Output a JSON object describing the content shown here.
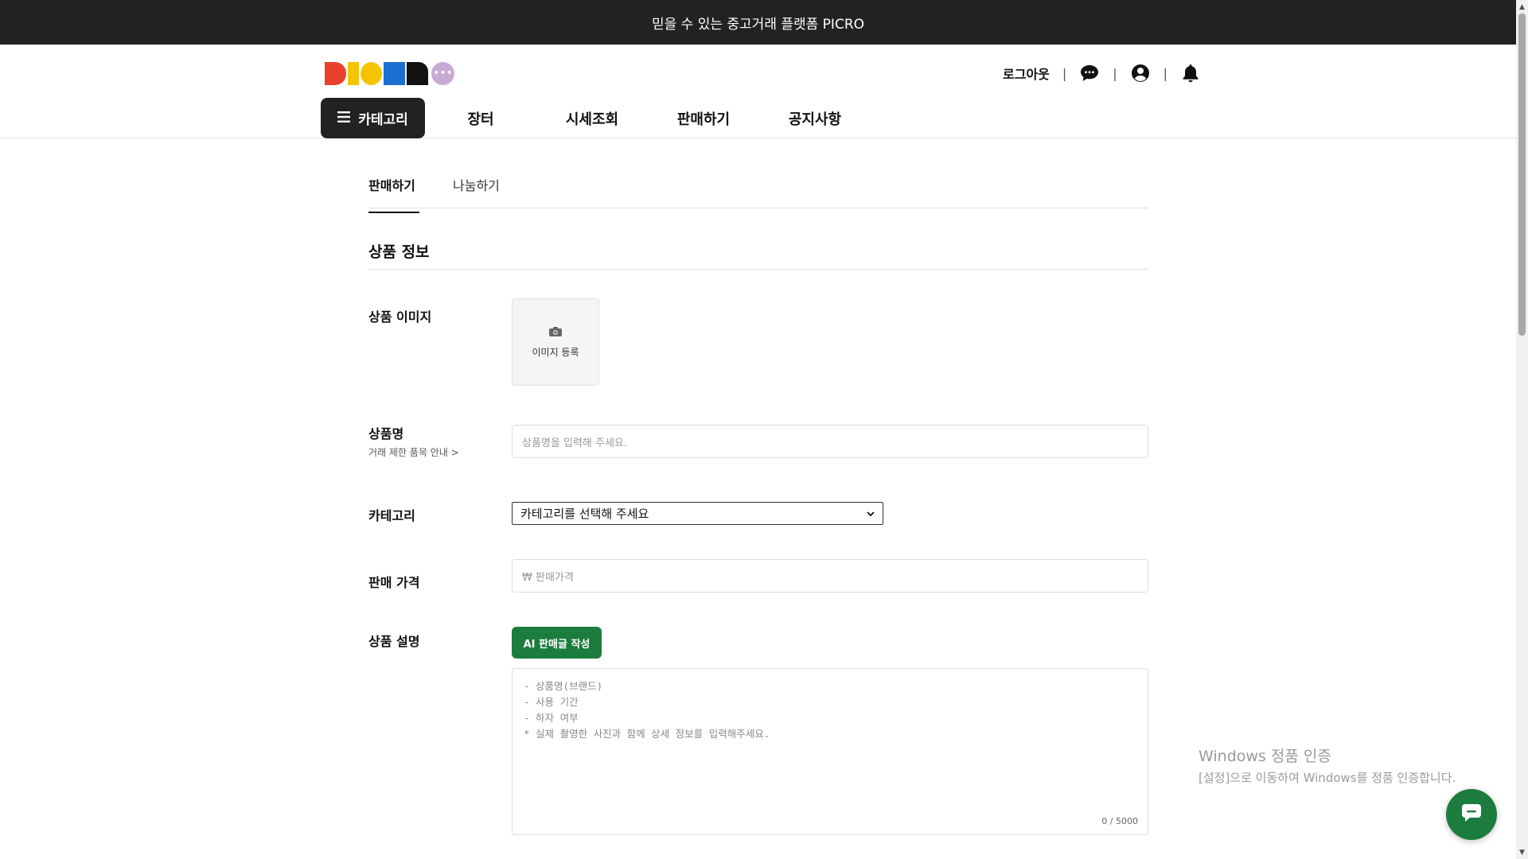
{
  "announcement": "믿을 수 있는 중고거래 플랫폼 PICRO",
  "header": {
    "logo_alt": "PICRO",
    "logout_label": "로그아웃",
    "separator": "|"
  },
  "nav": {
    "category_button": "카테고리",
    "items": [
      "장터",
      "시세조회",
      "판매하기",
      "공지사항"
    ]
  },
  "tabs": {
    "sell": "판매하기",
    "share": "나눔하기"
  },
  "form": {
    "section_title": "상품 정보",
    "image": {
      "label": "상품 이미지",
      "register": "이미지 등록"
    },
    "name": {
      "label": "상품명",
      "sublabel": "거래 제한 품목 안내 >",
      "placeholder": "상품명을 입력해 주세요."
    },
    "category": {
      "label": "카테고리",
      "selected": "카테고리를 선택해 주세요"
    },
    "price": {
      "label": "판매 가격",
      "placeholder": "₩ 판매가격"
    },
    "description": {
      "label": "상품 설명",
      "ai_button": "AI 판매글 작성",
      "placeholder_lines": [
        "- 상품명(브랜드)",
        "- 사용 기간",
        "- 하자 여부",
        "* 실제 촬영한 사진과 함께 상세 정보를 입력해주세요."
      ],
      "counter": "0 / 5000"
    }
  },
  "watermark": {
    "title": "Windows 정품 인증",
    "subtitle": "[설정]으로 이동하여 Windows를 정품 인증합니다."
  },
  "colors": {
    "topbar": "#222222",
    "accent_green": "#1b7c3d"
  }
}
